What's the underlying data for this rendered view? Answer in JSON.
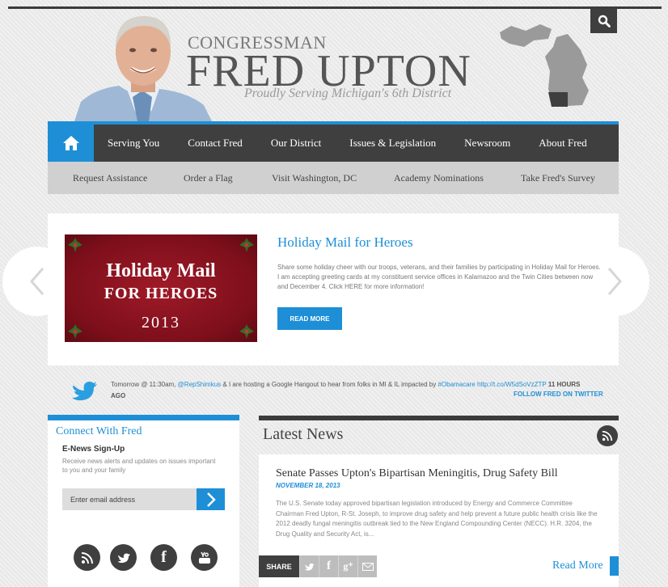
{
  "header": {
    "congressman": "CONGRESSMAN",
    "name": "FRED UPTON",
    "tagline": "Proudly Serving Michigan's 6th District"
  },
  "search": {
    "icon": "search-icon"
  },
  "nav": {
    "home_icon": "home-icon",
    "items": [
      "Serving You",
      "Contact Fred",
      "Our District",
      "Issues & Legislation",
      "Newsroom",
      "About Fred"
    ]
  },
  "subnav": {
    "items": [
      "Request Assistance",
      "Order a Flag",
      "Visit Washington, DC",
      "Academy Nominations",
      "Take Fred's Survey"
    ]
  },
  "slider": {
    "image_line1": "Holiday Mail",
    "image_line2": "FOR HEROES",
    "image_line3": "2013",
    "title": "Holiday Mail for Heroes",
    "text": "Share some holiday cheer with our troops, veterans, and their families by participating in Holiday Mail for Heroes. I am accepting greeting cards at my constituent service offices in Kalamazoo and the Twin Cities between now and December 4. Click HERE for more information!",
    "button": "READ MORE"
  },
  "tweet": {
    "part1": "Tomorrow @ 11:30am, ",
    "mention": "@RepShimkus",
    "part2": " & I are hosting a Google Hangout to hear from folks in MI & IL impacted by ",
    "hashtag": "#Obamacare",
    "url": "http://t.co/W5dSoVzZTP",
    "time": "11 HOURS AGO",
    "follow": "FOLLOW FRED ON TWITTER"
  },
  "connect": {
    "title": "Connect With Fred",
    "enews_label": "E-News Sign-Up",
    "enews_desc": "Receive news alerts and updates on issues important to you and your family",
    "email_placeholder": "Enter email address",
    "social_icons": [
      "rss-icon",
      "twitter-icon",
      "facebook-icon",
      "youtube-icon"
    ]
  },
  "news": {
    "title": "Latest News",
    "article_title": "Senate Passes Upton's Bipartisan Meningitis, Drug Safety Bill",
    "article_date": "NOVEMBER 18, 2013",
    "article_text": "The U.S. Senate today approved bipartisan legislation introduced by Energy and Commerce Committee Chairman Fred Upton, R-St. Joseph, to improve drug safety and help prevent a future public health crisis like the 2012 deadly fungal meningitis outbreak tied to the New England Compounding Center (NECC). H.R. 3204, the Drug Quality and Security Act, is...",
    "share_label": "SHARE",
    "read_more": "Read More"
  },
  "colors": {
    "accent": "#1e8fd6",
    "dark": "#3f3f3f",
    "subnav": "#d0d0d0",
    "promo": "#8b1421"
  }
}
